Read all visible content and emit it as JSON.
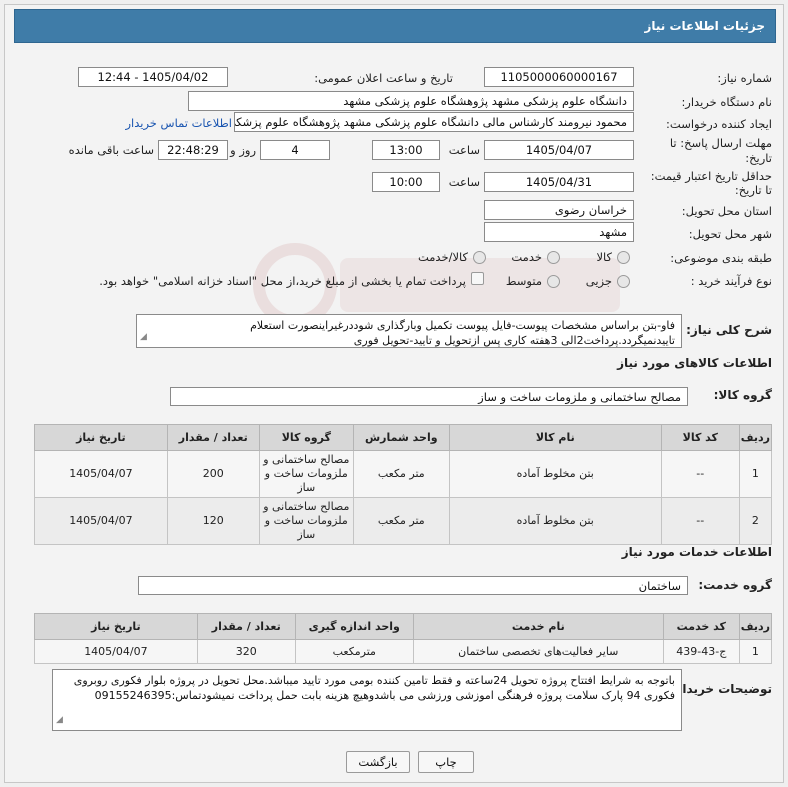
{
  "header": {
    "title": "جزئیات اطلاعات نیاز"
  },
  "form": {
    "need_number_label": "شماره نیاز:",
    "need_number": "1105000060000167",
    "announce_label": "تاریخ و ساعت اعلان عمومی:",
    "announce_value": "1405/04/02 - 12:44",
    "buyer_org_label": "نام دستگاه خریدار:",
    "buyer_org": "دانشگاه علوم پزشکی مشهد   پژوهشگاه علوم پزشکی مشهد",
    "requester_label": "ایجاد کننده درخواست:",
    "requester": "محمود نیرومند کارشناس مالی دانشگاه علوم پزشکی مشهد   پژوهشگاه علوم پزشکی مشهد",
    "contact_link": "اطلاعات تماس خریدار",
    "send_deadline_label1": "مهلت ارسال پاسخ: تا",
    "send_deadline_label2": "تاریخ:",
    "send_date": "1405/04/07",
    "time_label": "ساعت",
    "send_time": "13:00",
    "days_value": "4",
    "days_label": "روز و",
    "remaining_time": "22:48:29",
    "remaining_label": "ساعت باقی مانده",
    "price_validity_label1": "حداقل تاریخ اعتبار قیمت:",
    "price_validity_label2": "تا تاریخ:",
    "price_date": "1405/04/31",
    "price_time": "10:00",
    "province_label": "استان محل تحویل:",
    "province": "خراسان رضوی",
    "city_label": "شهر محل تحویل:",
    "city": "مشهد",
    "category_label": "طبقه بندی موضوعی:",
    "category_options": [
      "کالا",
      "خدمت",
      "کالا/خدمت"
    ],
    "category_value": "کالا/خدمت",
    "purchase_type_label": "نوع فرآیند خرید :",
    "purchase_options": [
      "جزیی",
      "متوسط"
    ],
    "payment_text": "پرداخت تمام یا بخشی از مبلغ خرید،از محل \"اسناد خزانه اسلامی\" خواهد بود."
  },
  "description": {
    "label": "شرح کلی نیاز:",
    "text": "فاو-بتن براساس مشخصات پیوست-فایل پیوست تکمیل وبارگذاری شوددرغیراینصورت استعلام تاییدنمیگردد.پرداخت2الی 3هفته کاری پس ازتحویل و تایید-تحویل فوری"
  },
  "goods": {
    "section_title": "اطلاعات کالاهای مورد نیاز",
    "group_label": "گروه کالا:",
    "group_value": "مصالح ساختمانی و ملزومات ساخت و ساز",
    "headers": [
      "ردیف",
      "کد کالا",
      "نام کالا",
      "واحد شمارش",
      "گروه کالا",
      "تعداد / مقدار",
      "تاریخ نیاز"
    ],
    "rows": [
      {
        "row": "1",
        "code": "--",
        "name": "بتن مخلوط آماده",
        "unit": "متر مکعب",
        "group": "مصالح ساختمانی و ملزومات ساخت و ساز",
        "qty": "200",
        "date": "1405/04/07"
      },
      {
        "row": "2",
        "code": "--",
        "name": "بتن مخلوط آماده",
        "unit": "متر مکعب",
        "group": "مصالح ساختمانی و ملزومات ساخت و ساز",
        "qty": "120",
        "date": "1405/04/07"
      }
    ]
  },
  "services": {
    "section_title": "اطلاعات خدمات مورد نیاز",
    "group_label": "گروه خدمت:",
    "group_value": "ساختمان",
    "headers": [
      "ردیف",
      "کد خدمت",
      "نام خدمت",
      "واحد اندازه گیری",
      "تعداد / مقدار",
      "تاریخ نیاز"
    ],
    "rows": [
      {
        "row": "1",
        "code": "ج-43-439",
        "name": "سایر فعالیت‌های تخصصی ساختمان",
        "unit": "مترمکعب",
        "qty": "320",
        "date": "1405/04/07"
      }
    ]
  },
  "buyer_notes": {
    "label": "توضیحات خریدار:",
    "text": "باتوجه به شرایط افتتاح پروژه تحویل 24ساعته و فقط تامین کننده بومی مورد تایید میباشد.محل تحویل در پروژه بلوار فکوری روبروی فکوری 94 پارک سلامت پروژه فرهنگی اموزشی ورزشی می باشدوهیچ هزینه بابت حمل  پرداخت نمیشودتماس:09155246395"
  },
  "buttons": {
    "print": "چاپ",
    "back": "بازگشت"
  }
}
